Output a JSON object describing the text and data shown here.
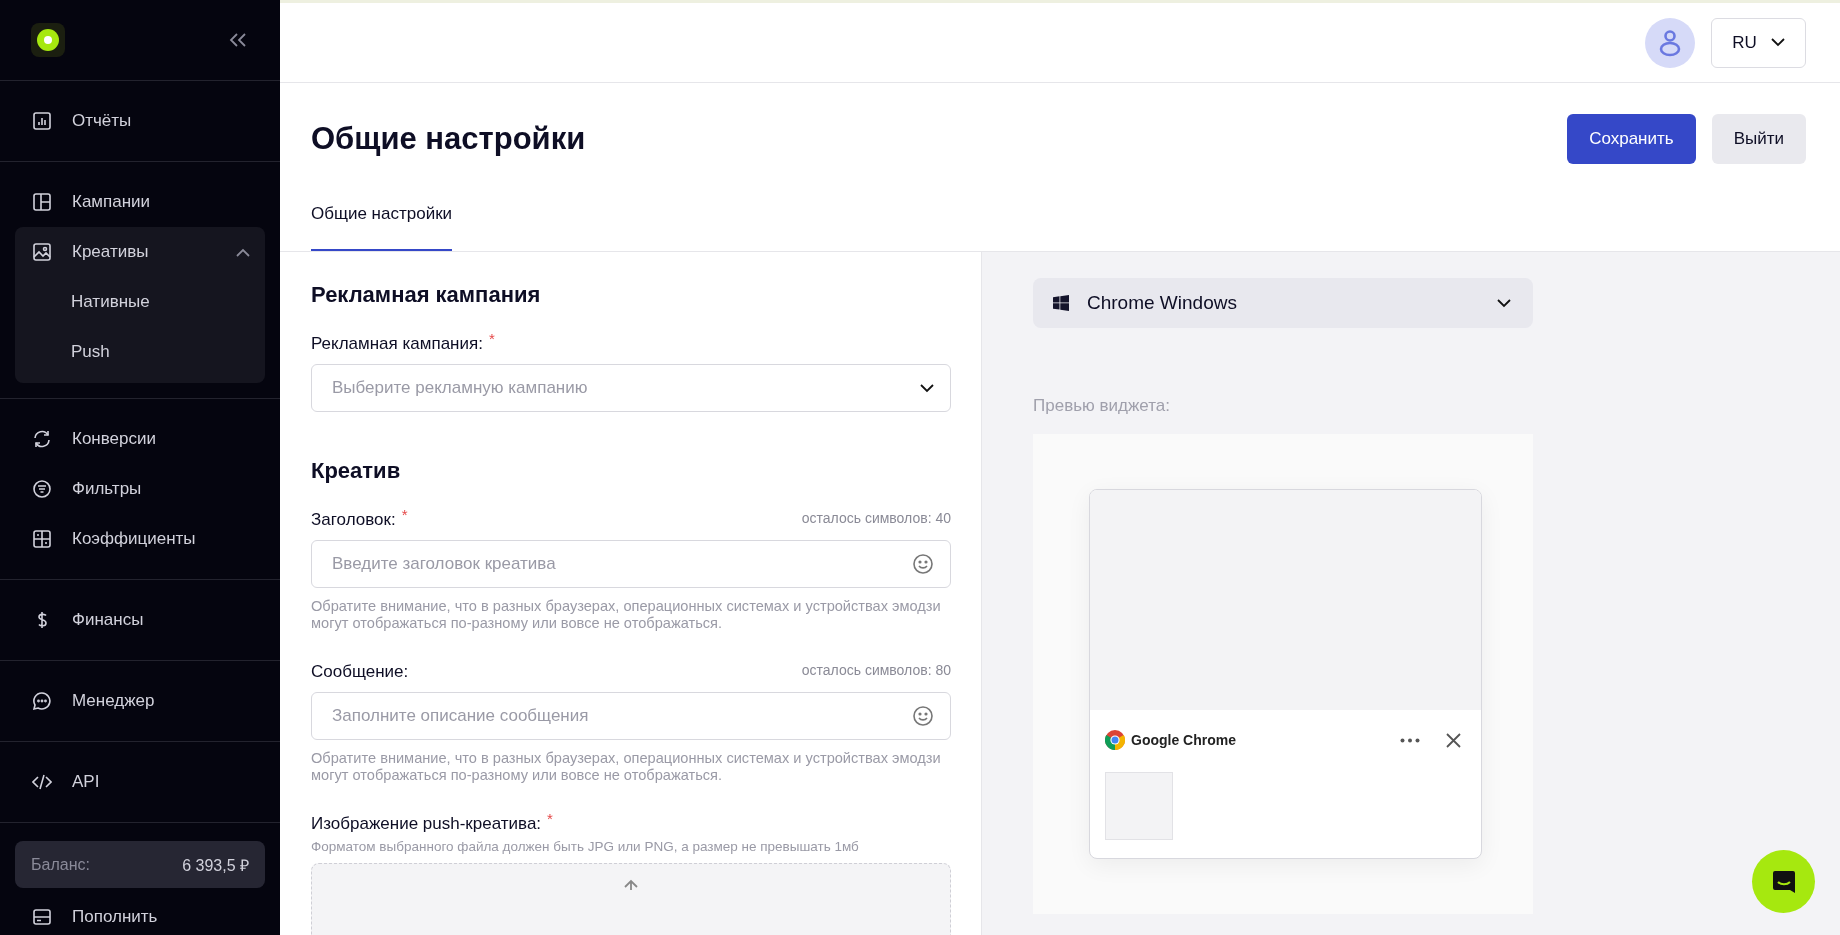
{
  "sidebar": {
    "sections": [
      [
        {
          "label": "Отчёты",
          "selected": false
        }
      ],
      [
        {
          "label": "Кампании",
          "selected": false
        },
        {
          "label": "Креативы",
          "selected": false,
          "expanded": true,
          "children": [
            {
              "label": "Нативные",
              "selected": false
            },
            {
              "label": "Push",
              "selected": false
            }
          ]
        }
      ],
      [
        {
          "label": "Конверсии",
          "selected": false
        },
        {
          "label": "Фильтры",
          "selected": false
        },
        {
          "label": "Коэффициенты",
          "selected": false
        }
      ],
      [
        {
          "label": "Финансы",
          "selected": false
        }
      ],
      [
        {
          "label": "Менеджер",
          "selected": false
        }
      ],
      [
        {
          "label": "API",
          "selected": false
        }
      ]
    ],
    "balance": {
      "label": "Баланс:",
      "value": "6 393,5 ₽"
    },
    "top_up": "Пополнить"
  },
  "header": {
    "language": "RU"
  },
  "page": {
    "title": "Общие настройки",
    "buttons": [
      {
        "label": "Сохранить",
        "kind": "primary"
      },
      {
        "label": "Выйти",
        "kind": "secondary"
      }
    ]
  },
  "tabs": [
    {
      "label": "Общие настройки",
      "selected": true
    }
  ],
  "form": [
    {
      "heading": "Рекламная кампания",
      "fields": [
        {
          "kind": "select",
          "label": "Рекламная кампания:",
          "required_mark": "*",
          "placeholder": "Выберите рекламную кампанию"
        }
      ]
    },
    {
      "heading": "Креатив",
      "fields": [
        {
          "kind": "text",
          "label": "Заголовок:",
          "required_mark": "*",
          "counter": "осталось символов: 40",
          "placeholder": "Введите заголовок креатива",
          "hint": "Обратите внимание, что в разных браузерах, операционных системах и устройствах эмодзи могут отображаться по-разному или вовсе не отображаться."
        },
        {
          "kind": "text",
          "label": "Сообщение:",
          "counter": "осталось символов: 80",
          "placeholder": "Заполните описание сообщения",
          "hint": "Обратите внимание, что в разных браузерах, операционных системах и устройствах эмодзи могут отображаться по-разному или вовсе не отображаться."
        },
        {
          "kind": "upload",
          "label": "Изображение push-креатива:",
          "required_mark": "*",
          "hint": "Форматом выбранного файла должен быть JPG или PNG, а размер не превышать 1мб"
        }
      ]
    }
  ],
  "preview": {
    "platform": "Chrome Windows",
    "label": "Превью виджета:",
    "browser": "Google Chrome"
  }
}
